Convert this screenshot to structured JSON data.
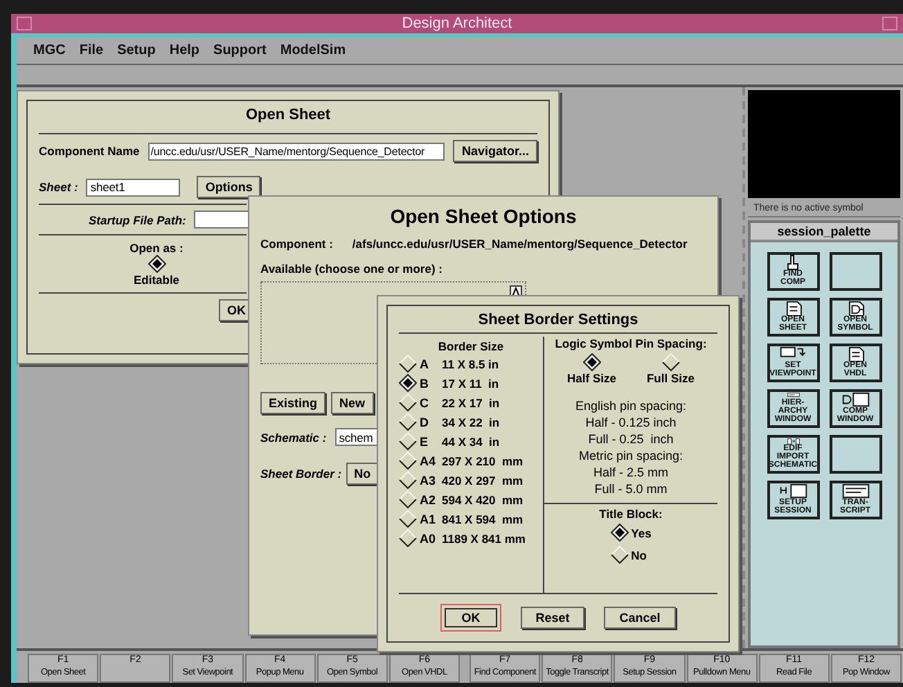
{
  "window": {
    "title": "Design Architect"
  },
  "menu_bar": [
    "MGC",
    "File",
    "Setup",
    "Help",
    "Support",
    "ModelSim"
  ],
  "open_sheet": {
    "title": "Open Sheet",
    "component_label": "Component Name",
    "component_value": "/uncc.edu/usr/USER_Name/mentorg/Sequence_Detector",
    "navigator_button": "Navigator...",
    "sheet_label": "Sheet :",
    "sheet_value": "sheet1",
    "options_button": "Options",
    "startup_label": "Startup File Path:",
    "open_as_label": "Open as :",
    "open_as": [
      {
        "label": "Editable",
        "selected": true
      }
    ],
    "ok_button": "OK"
  },
  "open_sheet_options": {
    "title": "Open Sheet Options",
    "component_label": "Component :",
    "component_value": "/afs/uncc.edu/usr/USER_Name/mentorg/Sequence_Detector",
    "available_label": "Available (choose one or more) :",
    "buttons": [
      "Existing",
      "New"
    ],
    "schematic_label": "Schematic :",
    "schematic_value": "schem",
    "sheet_border_label": "Sheet Border :",
    "sheet_border_button": "No"
  },
  "sheet_border_settings": {
    "title": "Sheet Border Settings",
    "border_size_label": "Border Size",
    "border_sizes": [
      {
        "code": "A",
        "size": "11 X 8.5 in",
        "selected": false
      },
      {
        "code": "B",
        "size": "17 X 11  in",
        "selected": true
      },
      {
        "code": "C",
        "size": "22 X 17  in",
        "selected": false
      },
      {
        "code": "D",
        "size": "34 X 22  in",
        "selected": false
      },
      {
        "code": "E",
        "size": "44 X 34  in",
        "selected": false
      },
      {
        "code": "A4",
        "size": "297 X 210  mm",
        "selected": false
      },
      {
        "code": "A3",
        "size": "420 X 297  mm",
        "selected": false
      },
      {
        "code": "A2",
        "size": "594 X 420  mm",
        "selected": false
      },
      {
        "code": "A1",
        "size": "841 X 594  mm",
        "selected": false
      },
      {
        "code": "A0",
        "size": "1189 X 841 mm",
        "selected": false
      }
    ],
    "pin_spacing_label": "Logic Symbol Pin Spacing:",
    "pin_spacing": [
      {
        "label": "Half Size",
        "selected": true
      },
      {
        "label": "Full Size",
        "selected": false
      }
    ],
    "info_lines": [
      "English pin spacing:",
      "Half - 0.125 inch",
      "Full - 0.25  inch",
      "Metric pin spacing:",
      "Half - 2.5 mm",
      "Full - 5.0 mm"
    ],
    "title_block_label": "Title Block:",
    "title_block": [
      {
        "label": "Yes",
        "selected": true
      },
      {
        "label": "No",
        "selected": false
      }
    ],
    "buttons": [
      {
        "label": "OK",
        "focused": true
      },
      {
        "label": "Reset",
        "focused": false
      },
      {
        "label": "Cancel",
        "focused": false
      }
    ]
  },
  "symbol_view": {
    "status": "There is no active symbol"
  },
  "session_palette": {
    "title": "session_palette",
    "items": [
      {
        "kind": "find",
        "lines": [
          "FIND",
          "COMP"
        ]
      },
      {
        "kind": "empty"
      },
      {
        "kind": "sheet",
        "lines": [
          "OPEN",
          "SHEET"
        ]
      },
      {
        "kind": "symbol",
        "lines": [
          "OPEN",
          "SYMBOL"
        ]
      },
      {
        "kind": "viewpoint",
        "lines": [
          "SET",
          "VIEWPOINT"
        ]
      },
      {
        "kind": "vhdl",
        "lines": [
          "OPEN",
          "VHDL"
        ]
      },
      {
        "kind": "hierarchy",
        "lines": [
          "HIER-",
          "ARCHY",
          "WINDOW"
        ]
      },
      {
        "kind": "comp",
        "lines": [
          "COMP",
          "WINDOW"
        ]
      },
      {
        "kind": "import",
        "lines": [
          "EDIF",
          "IMPORT",
          "SCHEMATIC"
        ]
      },
      {
        "kind": "empty"
      },
      {
        "kind": "setup",
        "lines": [
          "SETUP",
          "SESSION"
        ]
      },
      {
        "kind": "transcript",
        "lines": [
          "TRAN-",
          "SCRIPT"
        ]
      }
    ]
  },
  "function_keys": [
    {
      "key": "F1",
      "label": "Open Sheet"
    },
    {
      "key": "F2"
    },
    {
      "key": "F3",
      "label": "Set Viewpoint"
    },
    {
      "key": "F4",
      "label": "Popup Menu"
    },
    {
      "key": "F5",
      "label": "Open Symbol"
    },
    {
      "key": "F6",
      "label": "Open VHDL"
    },
    {
      "key": "F7",
      "label": "Find Component"
    },
    {
      "key": "F8",
      "label": "Toggle Transcript"
    },
    {
      "key": "F9",
      "label": "Setup Session"
    },
    {
      "key": "F10",
      "label": "Pulldown Menu"
    },
    {
      "key": "F11",
      "label": "Read File"
    },
    {
      "key": "F12",
      "label": "Pop Window"
    }
  ]
}
